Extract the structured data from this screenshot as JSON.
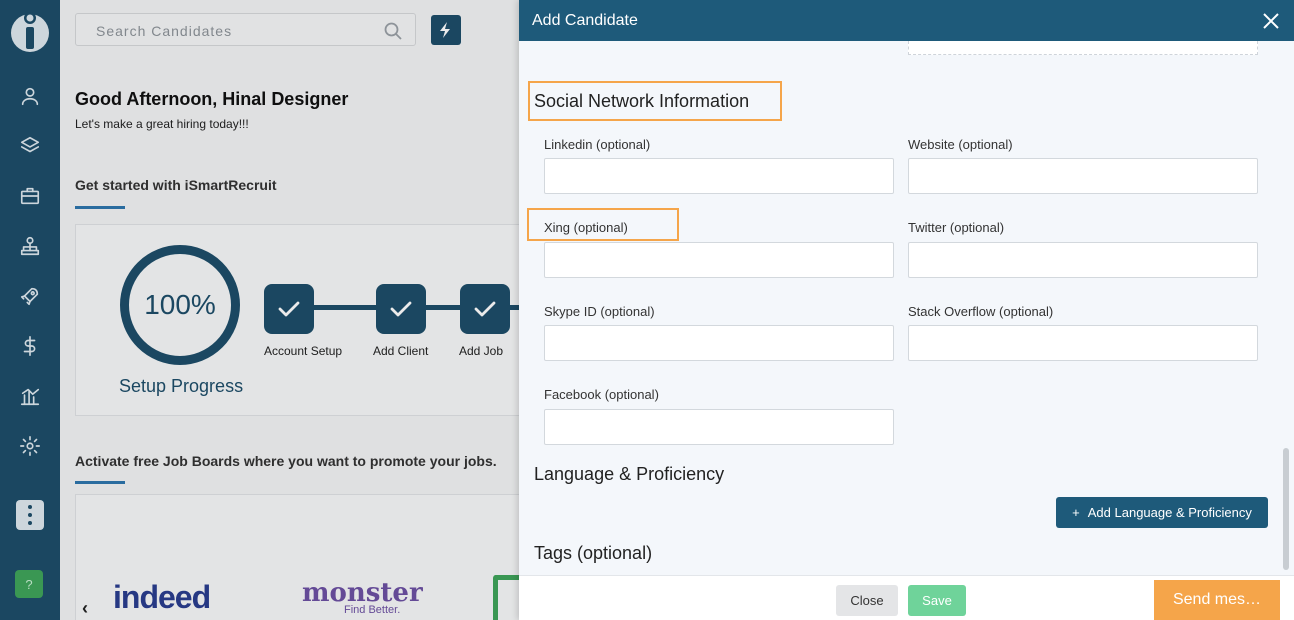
{
  "sidebar": {
    "logo": "ismartrecruit-logo",
    "items": [
      {
        "icon": "user-icon"
      },
      {
        "icon": "layers-icon"
      },
      {
        "icon": "briefcase-icon"
      },
      {
        "icon": "org-chart-icon"
      },
      {
        "icon": "rocket-icon"
      },
      {
        "icon": "dollar-icon"
      },
      {
        "icon": "analytics-icon"
      },
      {
        "icon": "gear-icon"
      }
    ],
    "help_label": "?"
  },
  "main": {
    "search_placeholder": "Search Candidates",
    "greeting": "Good Afternoon,  Hinal Designer",
    "subgreeting": "Let's make a great hiring today!!!",
    "get_started_title": "Get started with iSmartRecruit",
    "progress_value": "100%",
    "progress_label": "Setup Progress",
    "steps": [
      {
        "label": "Account Setup"
      },
      {
        "label": "Add Client"
      },
      {
        "label": "Add Job"
      }
    ],
    "jobboards_title": "Activate free Job Boards where you want to promote your jobs.",
    "jobboards": {
      "indeed": "indeed",
      "monster": "monster",
      "monster_tagline": "Find Better."
    }
  },
  "modal": {
    "title": "Add Candidate",
    "social_title": "Social Network Information",
    "fields": {
      "linkedin": "Linkedin (optional)",
      "website": "Website (optional)",
      "xing": "Xing (optional)",
      "twitter": "Twitter (optional)",
      "skype": "Skype ID (optional)",
      "stackoverflow": "Stack Overflow (optional)",
      "facebook": "Facebook (optional)"
    },
    "language_title": "Language & Proficiency",
    "add_language_label": "Add Language & Proficiency",
    "tags_title": "Tags (optional)",
    "close_label": "Close",
    "save_label": "Save"
  },
  "chat": {
    "label": "Send mes…"
  },
  "colors": {
    "nav": "#1e4e6a",
    "header": "#1e5a7a",
    "highlight": "#f5a54a",
    "save": "#6fd39a"
  }
}
